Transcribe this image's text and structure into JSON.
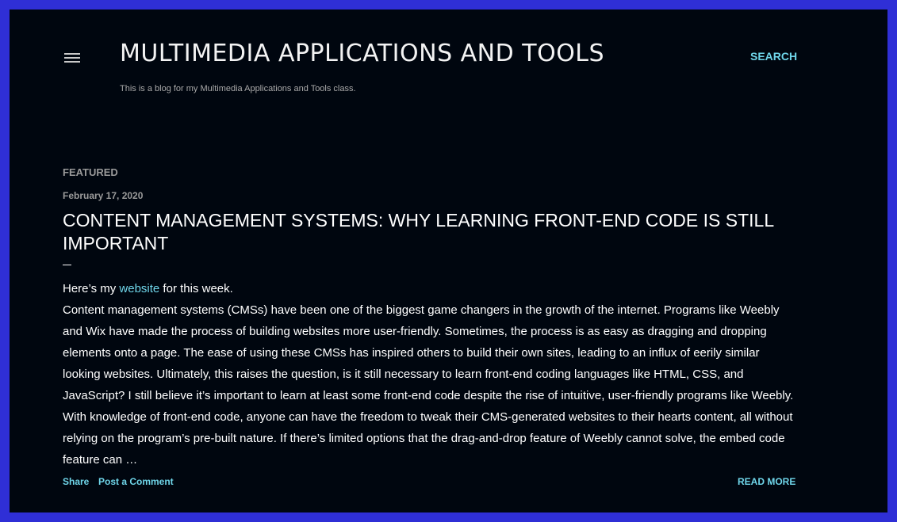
{
  "header": {
    "title": "MULTIMEDIA APPLICATIONS AND TOOLS",
    "description": "This is a blog for my Multimedia Applications and Tools class.",
    "search_label": "SEARCH",
    "menu_icon": "hamburger-menu-icon"
  },
  "post": {
    "section_label": "FEATURED",
    "date": "February 17, 2020",
    "title": "CONTENT MANAGEMENT SYSTEMS: WHY LEARNING FRONT-END CODE IS STILL IMPORTANT",
    "intro_prefix": "Here’s my ",
    "intro_link": "website",
    "intro_suffix": " for this week.",
    "body": "Content management systems (CMSs) have been one of the biggest game changers in the growth of the internet. Programs like Weebly and Wix have made the process of building websites more user-friendly. Sometimes, the process is as easy as dragging and dropping elements onto a page. The ease of using these CMSs has inspired others to build their own sites, leading to an influx of eerily similar looking websites. Ultimately, this raises the question, is it still necessary to learn front-end coding languages like HTML, CSS, and JavaScript? I still believe it’s important to learn at least some front-end code despite the rise of intuitive, user-friendly programs like Weebly. With knowledge of front-end code, anyone can have the freedom to tweak their CMS-generated websites to their hearts content, all without relying on the program’s pre-built nature. If there’s limited options that the drag-and-drop feature of Weebly cannot solve, the embed code feature can …",
    "share_label": "Share",
    "comment_label": "Post a Comment",
    "read_more_label": "READ MORE"
  },
  "colors": {
    "frame_border": "#2f2fd6",
    "background": "#00060f",
    "accent": "#6fd6ea",
    "text": "#ffffff",
    "muted": "#9a9a9a"
  }
}
